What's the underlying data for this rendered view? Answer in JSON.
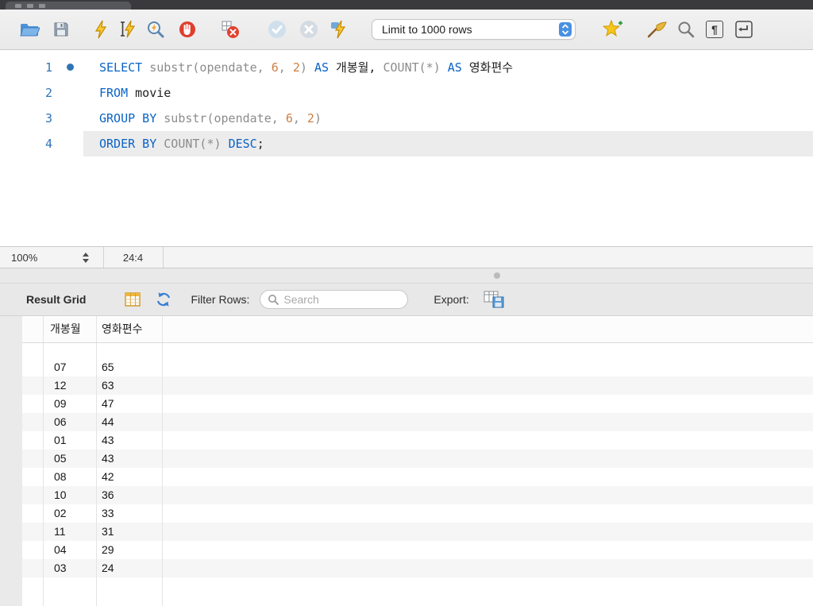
{
  "colors": {
    "keyword": "#0a63c6",
    "function_gray": "#8c8c8c",
    "number": "#cd7f43",
    "plain": "#1f1f1f",
    "line_number": "#2f74b5",
    "accent_blue": "#4a90e2"
  },
  "toolbar": {
    "limit_dropdown_value": "Limit to 1000 rows"
  },
  "icons": {
    "pilcrow": "¶"
  },
  "editor": {
    "lines": [
      {
        "num": "1",
        "marker": true,
        "tokens": [
          {
            "t": "SELECT",
            "c": "keyword"
          },
          {
            "t": " ",
            "c": "plain"
          },
          {
            "t": "substr(opendate, ",
            "c": "function_gray"
          },
          {
            "t": "6",
            "c": "number"
          },
          {
            "t": ", ",
            "c": "function_gray"
          },
          {
            "t": "2",
            "c": "number"
          },
          {
            "t": ") ",
            "c": "function_gray"
          },
          {
            "t": "AS",
            "c": "keyword"
          },
          {
            "t": " 개봉월, ",
            "c": "plain"
          },
          {
            "t": "COUNT(*)",
            "c": "function_gray"
          },
          {
            "t": " ",
            "c": "plain"
          },
          {
            "t": "AS",
            "c": "keyword"
          },
          {
            "t": " 영화편수",
            "c": "plain"
          }
        ]
      },
      {
        "num": "2",
        "tokens": [
          {
            "t": "FROM",
            "c": "keyword"
          },
          {
            "t": " movie",
            "c": "plain"
          }
        ]
      },
      {
        "num": "3",
        "tokens": [
          {
            "t": "GROUP BY",
            "c": "keyword"
          },
          {
            "t": " ",
            "c": "plain"
          },
          {
            "t": "substr(opendate, ",
            "c": "function_gray"
          },
          {
            "t": "6",
            "c": "number"
          },
          {
            "t": ", ",
            "c": "function_gray"
          },
          {
            "t": "2",
            "c": "number"
          },
          {
            "t": ")",
            "c": "function_gray"
          }
        ]
      },
      {
        "num": "4",
        "current": true,
        "tokens": [
          {
            "t": "ORDER BY",
            "c": "keyword"
          },
          {
            "t": " ",
            "c": "plain"
          },
          {
            "t": "COUNT(*)",
            "c": "function_gray"
          },
          {
            "t": " ",
            "c": "plain"
          },
          {
            "t": "DESC",
            "c": "keyword"
          },
          {
            "t": ";",
            "c": "plain"
          }
        ]
      }
    ]
  },
  "status_bar": {
    "zoom": "100%",
    "caret_position": "24:4"
  },
  "result_panel": {
    "title": "Result Grid",
    "filter_label": "Filter Rows:",
    "search_placeholder": "Search",
    "export_label": "Export:"
  },
  "result_table": {
    "columns": [
      "개봉월",
      "영화편수"
    ],
    "rows": [
      [
        "07",
        "65"
      ],
      [
        "12",
        "63"
      ],
      [
        "09",
        "47"
      ],
      [
        "06",
        "44"
      ],
      [
        "01",
        "43"
      ],
      [
        "05",
        "43"
      ],
      [
        "08",
        "42"
      ],
      [
        "10",
        "36"
      ],
      [
        "02",
        "33"
      ],
      [
        "11",
        "31"
      ],
      [
        "04",
        "29"
      ],
      [
        "03",
        "24"
      ]
    ]
  }
}
